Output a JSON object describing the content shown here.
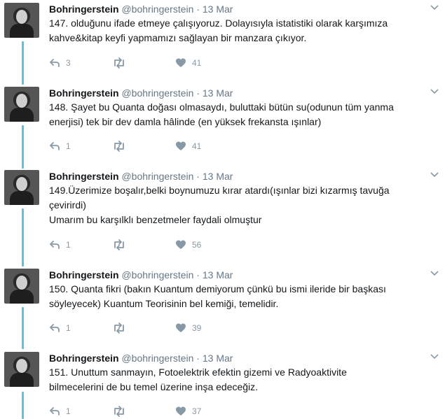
{
  "tweets": [
    {
      "name": "Bohringerstein",
      "handle": "@bohringerstein",
      "dot": "·",
      "date": "13 Mar",
      "lines": [
        "147. olduğunu ifade etmeye çalışıyoruz. Dolayısıyla istatistiki olarak karşımıza",
        "kahve&kitap keyfi yapmamızı sağlayan bir manzara çıkıyor."
      ],
      "replies": "3",
      "retweets": "",
      "likes": "41"
    },
    {
      "name": "Bohringerstein",
      "handle": "@bohringerstein",
      "dot": "·",
      "date": "13 Mar",
      "lines": [
        "148. Şayet bu Quanta doğası olmasaydı, buluttaki bütün su(odunun tüm yanma",
        "enerjisi) tek bir dev damla hâlinde (en yüksek frekansta ışınlar)"
      ],
      "replies": "1",
      "retweets": "",
      "likes": "41"
    },
    {
      "name": "Bohringerstein",
      "handle": "@bohringerstein",
      "dot": "·",
      "date": "13 Mar",
      "lines": [
        "149.Üzerimize boşalır,belki boynumuzu kırar atardı(ışınlar bizi kızarmış tavuğa",
        "çevirirdi)",
        "Umarım bu karşılklı benzetmeler faydali olmuştur"
      ],
      "replies": "1",
      "retweets": "",
      "likes": "56"
    },
    {
      "name": "Bohringerstein",
      "handle": "@bohringerstein",
      "dot": "·",
      "date": "13 Mar",
      "lines": [
        "150. Quanta fikri (bakın Kuantum demiyorum çünkü bu ismi ileride bir başkası",
        "söyleyecek) Kuantum Teorisinin bel kemiği, temelidir."
      ],
      "replies": "1",
      "retweets": "",
      "likes": "39"
    },
    {
      "name": "Bohringerstein",
      "handle": "@bohringerstein",
      "dot": "·",
      "date": "13 Mar",
      "lines": [
        "151. Unuttum sanmayın, Fotoelektrik efektin gizemi ve Radyoaktivite",
        "bilmecelerini de bu temel üzerine inşa edeceğiz."
      ],
      "replies": "1",
      "retweets": "",
      "likes": "37"
    }
  ],
  "icons": {
    "reply": "reply-icon",
    "retweet": "retweet-icon",
    "like": "heart-icon",
    "caret": "chevron-down-icon"
  },
  "colors": {
    "thread": "#5fc0e0",
    "meta": "#657786",
    "icon": "#8899a6"
  }
}
